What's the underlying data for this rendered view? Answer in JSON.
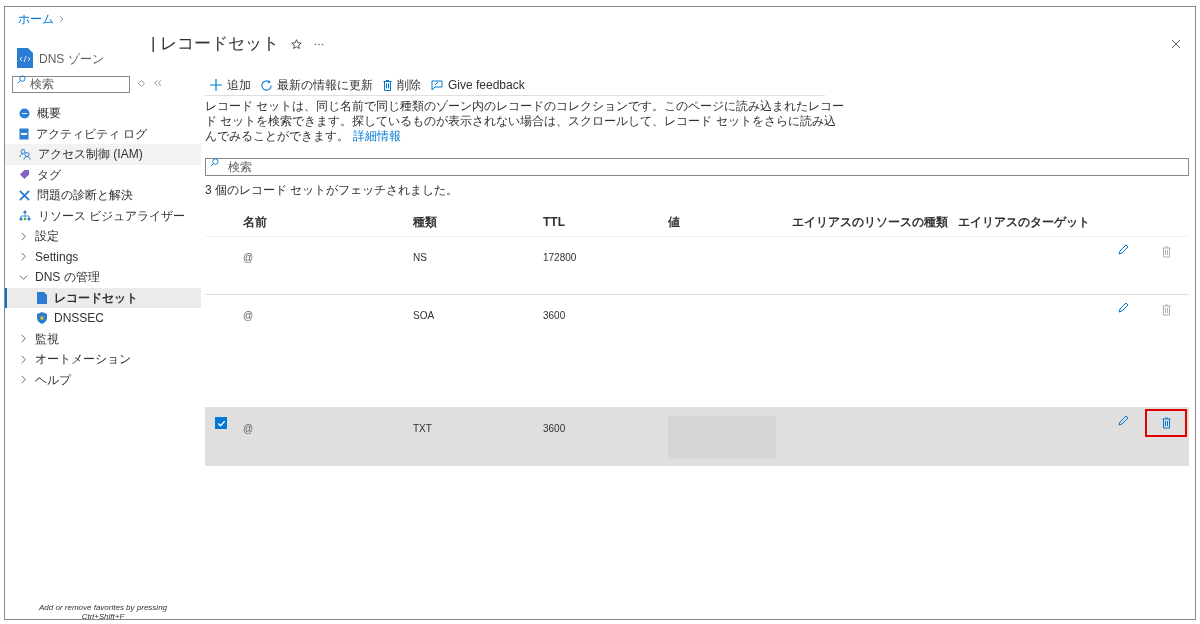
{
  "breadcrumb": [
    {
      "label": "ホーム"
    }
  ],
  "header": {
    "title": "| レコードセット",
    "subtitle": "DNS ゾーン",
    "favorite": false
  },
  "sidebar": {
    "search": {
      "placeholder": "検索"
    },
    "items": [
      {
        "label": "概要",
        "kind": "link",
        "selected": false,
        "hovered": false
      },
      {
        "label": "アクティビティ ログ",
        "kind": "link",
        "selected": false,
        "hovered": false
      },
      {
        "label": "アクセス制御 (IAM)",
        "kind": "link",
        "selected": false,
        "hovered": true
      },
      {
        "label": "タグ",
        "kind": "link",
        "selected": false,
        "hovered": false
      },
      {
        "label": "問題の診断と解決",
        "kind": "link",
        "selected": false,
        "hovered": false
      },
      {
        "label": "リソース ビジュアライザー",
        "kind": "link",
        "selected": false,
        "hovered": false
      },
      {
        "label": "設定",
        "kind": "group",
        "expanded": false
      },
      {
        "label": "Settings",
        "kind": "group",
        "expanded": false
      },
      {
        "label": "DNS の管理",
        "kind": "group",
        "expanded": true,
        "children": [
          {
            "label": "レコードセット",
            "kind": "link",
            "selected": true,
            "hovered": false
          },
          {
            "label": "DNSSEC",
            "kind": "link",
            "selected": false,
            "hovered": false
          }
        ]
      },
      {
        "label": "監視",
        "kind": "group",
        "expanded": false
      },
      {
        "label": "オートメーション",
        "kind": "group",
        "expanded": false
      },
      {
        "label": "ヘルプ",
        "kind": "group",
        "expanded": false
      }
    ],
    "favorites_hint": "Add or remove favorites by pressing Ctrl+Shift+F"
  },
  "toolbar": [
    {
      "label": "追加"
    },
    {
      "label": "最新の情報に更新"
    },
    {
      "label": "削除"
    },
    {
      "label": "Give feedback"
    }
  ],
  "description": {
    "text": "レコード セットは、同じ名前で同じ種類のゾーン内のレコードのコレクションです。このページに読み込まれたレコード セットを検索できます。探しているものが表示されない場合は、スクロールして、レコード セットをさらに読み込んでみることができます。",
    "link": "詳細情報"
  },
  "filter": {
    "placeholder": "検索"
  },
  "result_count": "3 個のレコード セットがフェッチされました。",
  "table": {
    "columns": [
      "名前",
      "種類",
      "TTL",
      "値",
      "エイリアスのリソースの種類",
      "エイリアスのターゲット"
    ],
    "rows": [
      {
        "name": "@",
        "type": "NS",
        "ttl": "172800",
        "checked": false,
        "value_redacted": false,
        "delete_enabled": false,
        "highlighted": false
      },
      {
        "name": "@",
        "type": "SOA",
        "ttl": "3600",
        "checked": false,
        "value_redacted": false,
        "delete_enabled": false,
        "highlighted": false
      },
      {
        "name": "@",
        "type": "TXT",
        "ttl": "3600",
        "checked": true,
        "value_redacted": true,
        "delete_enabled": true,
        "highlighted": true
      }
    ]
  }
}
